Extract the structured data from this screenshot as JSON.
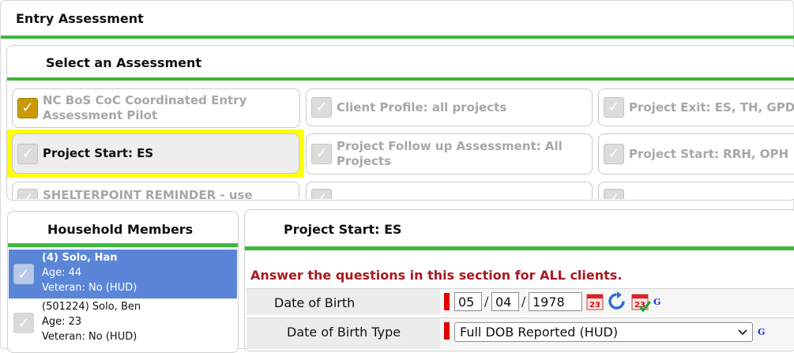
{
  "entry_title": "Entry Assessment",
  "select_title": "Select an Assessment",
  "assessments": [
    {
      "label": "NC BoS CoC Coordinated Entry Assessment Pilot"
    },
    {
      "label": "Client Profile: all projects"
    },
    {
      "label": "Project Exit: ES, TH, GPD"
    },
    {
      "label": "Project Start: ES"
    },
    {
      "label": "Project Follow up Assessment: All Projects"
    },
    {
      "label": "Project Start: RRH, OPH"
    },
    {
      "label": "SHELTERPOINT REMINDER - use"
    }
  ],
  "household_title": "Household Members",
  "members": [
    {
      "name": "(4) Solo, Han",
      "age": "Age: 44",
      "veteran": "Veteran: No (HUD)"
    },
    {
      "name": "(501224) Solo, Ben",
      "age": "Age: 23",
      "veteran": "Veteran: No (HUD)"
    }
  ],
  "main": {
    "title": "Project Start: ES",
    "note": "Answer the questions in this section for ALL clients.",
    "dob": {
      "label": "Date of Birth",
      "month": "05",
      "day": "04",
      "year": "1978",
      "sep": "/"
    },
    "dob_type": {
      "label": "Date of Birth Type",
      "value": "Full DOB Reported (HUD)"
    },
    "g_label": "G"
  },
  "colors": {
    "accent_green": "#3cb83c",
    "selected_blue": "#5b86d8",
    "note_red": "#aa1820",
    "highlight": "#ffff00"
  }
}
